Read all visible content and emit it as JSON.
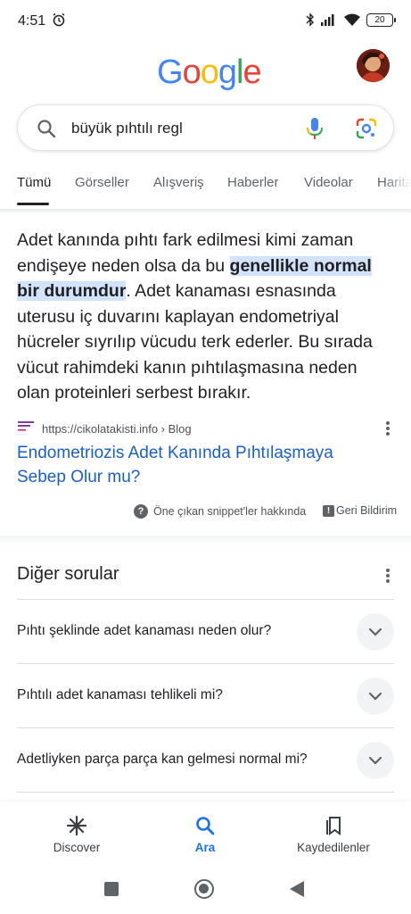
{
  "status_bar": {
    "time": "4:51",
    "battery": "20"
  },
  "header": {
    "logo_letters": [
      {
        "ch": "G",
        "color": "#4285F4"
      },
      {
        "ch": "o",
        "color": "#EA4335"
      },
      {
        "ch": "o",
        "color": "#FBBC05"
      },
      {
        "ch": "g",
        "color": "#4285F4"
      },
      {
        "ch": "l",
        "color": "#34A853"
      },
      {
        "ch": "e",
        "color": "#EA4335"
      }
    ]
  },
  "search": {
    "query": "büyük pıhtılı regl"
  },
  "tabs": [
    "Tümü",
    "Görseller",
    "Alışveriş",
    "Haberler",
    "Videolar",
    "Harita"
  ],
  "snippet": {
    "text_before": "Adet kanında pıhtı fark edilmesi kimi zaman endişeye neden olsa da bu ",
    "highlight": "genellikle normal bir durumdur",
    "text_after": ". Adet kanaması esnasında uterusu iç duvarını kaplayan endometriyal hücreler sıyrılıp vücudu terk ederler. Bu sırada vücut rahimdeki kanın pıhtılaşmasına neden olan proteinleri serbest bırakır.",
    "source_url": "https://cikolatakisti.info › Blog",
    "link_title": "Endometriozis Adet Kanında Pıhtılaşmaya Sebep Olur mu?",
    "about_label": "Öne çıkan snippet'ler hakkında",
    "feedback_label": "Geri Bildirim"
  },
  "other_questions": {
    "title": "Diğer sorular",
    "items": [
      "Pıhtı şeklinde adet kanaması neden olur?",
      "Pıhtılı adet kanaması tehlikeli mi?",
      "Adetliyken parça parça kan gelmesi normal mi?"
    ]
  },
  "bottom_nav": {
    "discover": "Discover",
    "search": "Ara",
    "saved": "Kaydedilenler"
  },
  "colors": {
    "link": "#1a5fc8",
    "highlight_bg": "#d3e3fd",
    "active_nav": "#1a73e8"
  }
}
